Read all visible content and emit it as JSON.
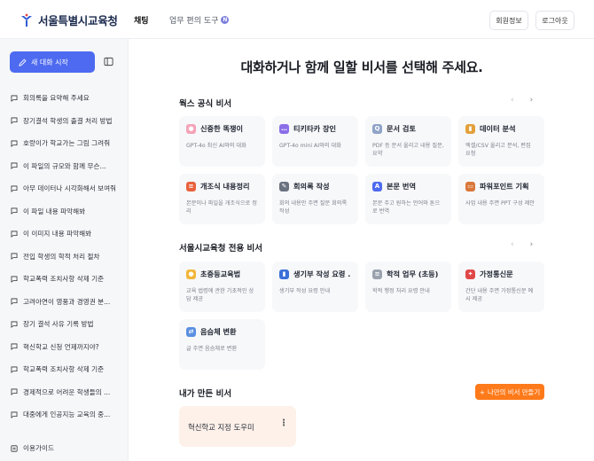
{
  "header": {
    "logo_text": "서울특별시교육청",
    "nav": {
      "chat": "채팅",
      "tools": "업무 편의 도구",
      "tools_badge": "N"
    },
    "member_btn": "회원정보",
    "logout_btn": "로그아웃"
  },
  "sidebar": {
    "new_chat": "새 대화 시작",
    "items": [
      "회의록을 요약해 주세요",
      "장기결석 학생의 출결 처리 방법",
      "호랑이가 학교가는 그림 그려줘",
      "이 파일의 규모와 함께 무슨...",
      "아무 데이터나 시각화해서 보여줘",
      "이 파일 내용 파악해봐",
      "이 이미지 내용 파악해봐",
      "전입 학생의 학적 처리 절차",
      "학교폭력 조치사항 삭제 기준",
      "고려아연이 영풍과 경영권 분...",
      "장기 결석 사유 기록 방법",
      "혁신학교 신청 언제까지야?",
      "학교폭력 조치사항 삭제 기준",
      "경제적으로 어려운 학생들의 ...",
      "대중에게 인공지능 교육의 중..."
    ],
    "guide": "이용가이드"
  },
  "main": {
    "title": "대화하거나 함께 일할 비서를 선택해 주세요.",
    "section1": {
      "title": "웍스 공식 비서",
      "cards": [
        {
          "name": "신중한 똑쟁이",
          "desc": "GPT-4o 최신 AI와의 대화",
          "icon": "brain-icon",
          "color": "#f4a3b8"
        },
        {
          "name": "티키타카 장인",
          "desc": "GPT-4o mini AI와의 대화",
          "icon": "chat-bubble-icon",
          "color": "#8b6ee8"
        },
        {
          "name": "문서 검토",
          "desc": "PDF 등 문서 올리고 내용 질문, 요약",
          "icon": "document-search-icon",
          "color": "#8fa3c7"
        },
        {
          "name": "데이터 분석",
          "desc": "엑셀/CSV 올리고 분석, 편집 요청",
          "icon": "chart-icon",
          "color": "#e3a03b"
        },
        {
          "name": "개조식 내용정리",
          "desc": "본문이나 파일을 개조식으로 정리",
          "icon": "list-icon",
          "color": "#e8623d"
        },
        {
          "name": "회의록 작성",
          "desc": "회의 내용만 주면 질문 회의록 작성",
          "icon": "memo-icon",
          "color": "#6a7280"
        },
        {
          "name": "본문 번역",
          "desc": "본문 주고 원하는 언어와 톤으로 번역",
          "icon": "translate-icon",
          "color": "#4d6af0"
        },
        {
          "name": "파워포인트 기획",
          "desc": "사업 내용 주면 PPT 구성 제안",
          "icon": "presentation-icon",
          "color": "#d9763a"
        }
      ]
    },
    "section2": {
      "title": "서울시교육청 전용 비서",
      "cards": [
        {
          "name": "초중등교육법",
          "desc": "교육 법령에 관한 기초적인 상담 제공",
          "icon": "person-icon",
          "color": "#f2b63b"
        },
        {
          "name": "생기부 작성 요령 ...",
          "desc": "생기부 작성 요령 안내",
          "icon": "book-icon",
          "color": "#3b6fd8"
        },
        {
          "name": "학적 업무 (초등)",
          "desc": "학적 행정 처리 요령 안내",
          "icon": "document-icon",
          "color": "#9aa2ae"
        },
        {
          "name": "가정통신문",
          "desc": "간단 내용 주면 가정통신문 예시 제공",
          "icon": "pin-icon",
          "color": "#e04848"
        },
        {
          "name": "음슴체 변환",
          "desc": "글 주면 음슴체로 변환",
          "icon": "convert-icon",
          "color": "#5a8fe0"
        }
      ]
    },
    "section3": {
      "title": "내가 만든 비서",
      "make_btn": "나만의 비서 만들기",
      "cards": [
        {
          "name": "혁신학교 지정 도우미"
        }
      ]
    },
    "arrows": {
      "prev": "‹",
      "next": "›"
    }
  }
}
